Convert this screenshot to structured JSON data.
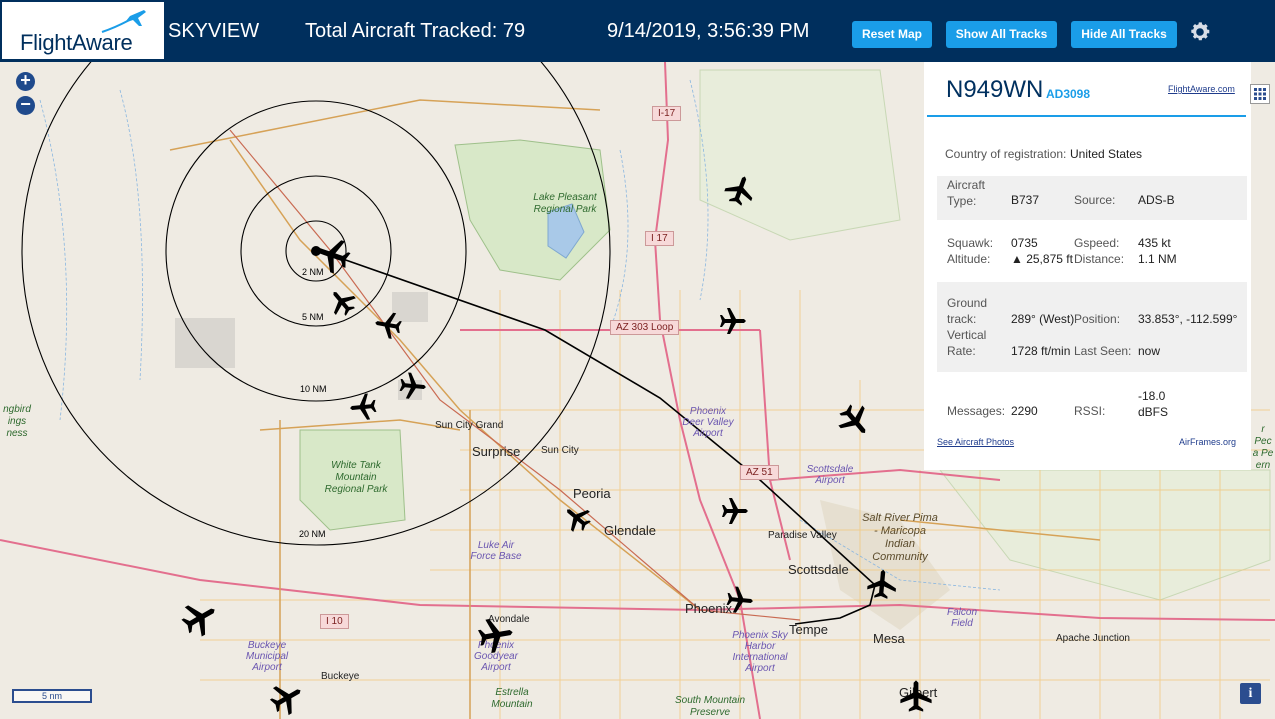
{
  "header": {
    "logo_text": "FlightAware",
    "app_title": "SKYVIEW",
    "tracked_label": "Total Aircraft Tracked: 79",
    "timestamp": "9/14/2019, 3:56:39 PM",
    "reset_label": "Reset Map",
    "show_label": "Show All Tracks",
    "hide_label": "Hide All Tracks",
    "brand_color": "#002f5d",
    "button_color": "#1a9de8"
  },
  "map": {
    "zoom_in": "+",
    "zoom_out": "−",
    "scale_label": "5 nm",
    "info_label": "i",
    "rings": [
      "2 NM",
      "5 NM",
      "10 NM",
      "20 NM"
    ],
    "shields": [
      "I-17",
      "I 17",
      "AZ 303 Loop",
      "AZ 51",
      "I 10"
    ],
    "labels": {
      "lake_pleasant": "Lake Pleasant Regional Park",
      "white_tank": "White Tank Mountain Regional Park",
      "sun_city_grand": "Sun City Grand",
      "surprise": "Surprise",
      "sun_city": "Sun City",
      "peoria": "Peoria",
      "glendale": "Glendale",
      "luke": "Luke Air Force Base",
      "phoenix_dv": "Phoenix Deer Valley Airport",
      "scottsdale_ap": "Scottsdale Airport",
      "paradise": "Paradise Valley",
      "scottsdale": "Scottsdale",
      "salt_river": "Salt River Pima - Maricopa Indian Community",
      "phoenix": "Phoenix",
      "tempe": "Tempe",
      "mesa": "Mesa",
      "falcon": "Falcon Field",
      "apache": "Apache Junction",
      "sky_harbor": "Phoenix Sky Harbor International Airport",
      "goodyear": "Phoenix Goodyear Airport",
      "avondale": "Avondale",
      "buckeye_ap": "Buckeye Municipal Airport",
      "buckeye": "Buckeye",
      "estrella": "Estrella Mountain",
      "south_mtn": "South Mountain Preserve",
      "gilbert": "Gilbert",
      "left_edge": "ngbird ings ness",
      "right_edge": "r Pec a Pe ern"
    }
  },
  "panel": {
    "registration": "N949WN",
    "flight_id": "AD3098",
    "fa_link": "FlightAware.com",
    "country_label": "Country of registration:",
    "country_value": "United States",
    "aircraft_type_label": "Aircraft Type:",
    "aircraft_type_value": "B737",
    "source_label": "Source:",
    "source_value": "ADS-B",
    "squawk_label": "Squawk:",
    "squawk_value": "0735",
    "gspeed_label": "Gspeed:",
    "gspeed_value": "435 kt",
    "altitude_label": "Altitude:",
    "altitude_value": "▲ 25,875 ft",
    "distance_label": "Distance:",
    "distance_value": "1.1 NM",
    "ground_track_label": "Ground track:",
    "ground_track_value": "289° (West)",
    "position_label": "Position:",
    "position_value": "33.853°, -112.599°",
    "vertical_rate_label": "Vertical Rate:",
    "vertical_rate_value": "1728 ft/min",
    "last_seen_label": "Last Seen:",
    "last_seen_value": "now",
    "messages_label": "Messages:",
    "messages_value": "2290",
    "rssi_label": "RSSI:",
    "rssi_value": "-18.0 dBFS",
    "photos_link": "See Aircraft Photos",
    "airframes_link": "AirFrames.org"
  }
}
